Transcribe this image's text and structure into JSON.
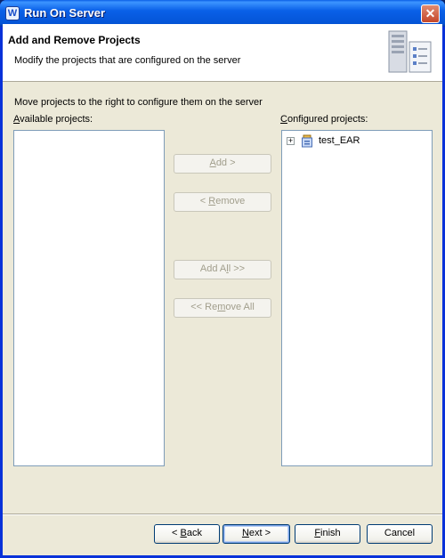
{
  "window": {
    "title": "Run On Server"
  },
  "banner": {
    "title": "Add and Remove Projects",
    "description": "Modify the projects that are configured on the server"
  },
  "instruction": "Move projects to the right to configure them on the server",
  "available": {
    "label_mnemonic": "A",
    "label_rest": "vailable projects:",
    "items": []
  },
  "configured": {
    "label_mnemonic": "C",
    "label_rest": "onfigured projects:",
    "items": [
      {
        "label": "test_EAR",
        "expanded": false
      }
    ]
  },
  "buttons": {
    "add": {
      "before": "",
      "mnemonic": "A",
      "after": "dd >"
    },
    "remove": {
      "before": "< ",
      "mnemonic": "R",
      "after": "emove"
    },
    "add_all": {
      "before": "Add A",
      "mnemonic": "l",
      "after": "l >>"
    },
    "remove_all": {
      "before": "<< Re",
      "mnemonic": "m",
      "after": "ove All"
    }
  },
  "footer": {
    "back": {
      "before": "< ",
      "mnemonic": "B",
      "after": "ack"
    },
    "next": {
      "mnemonic": "N",
      "after": "ext >"
    },
    "finish": {
      "mnemonic": "F",
      "after": "inish"
    },
    "cancel": "Cancel"
  },
  "icons": {
    "app": "eclipse-wtp-icon",
    "close": "close-icon",
    "banner": "server-icon",
    "project": "enterprise-project-icon"
  },
  "colors": {
    "titlebar": "#0a5fe6",
    "dialog_bg": "#ece9d8",
    "list_border": "#7f9db9",
    "disabled_text": "#a19e8c"
  }
}
